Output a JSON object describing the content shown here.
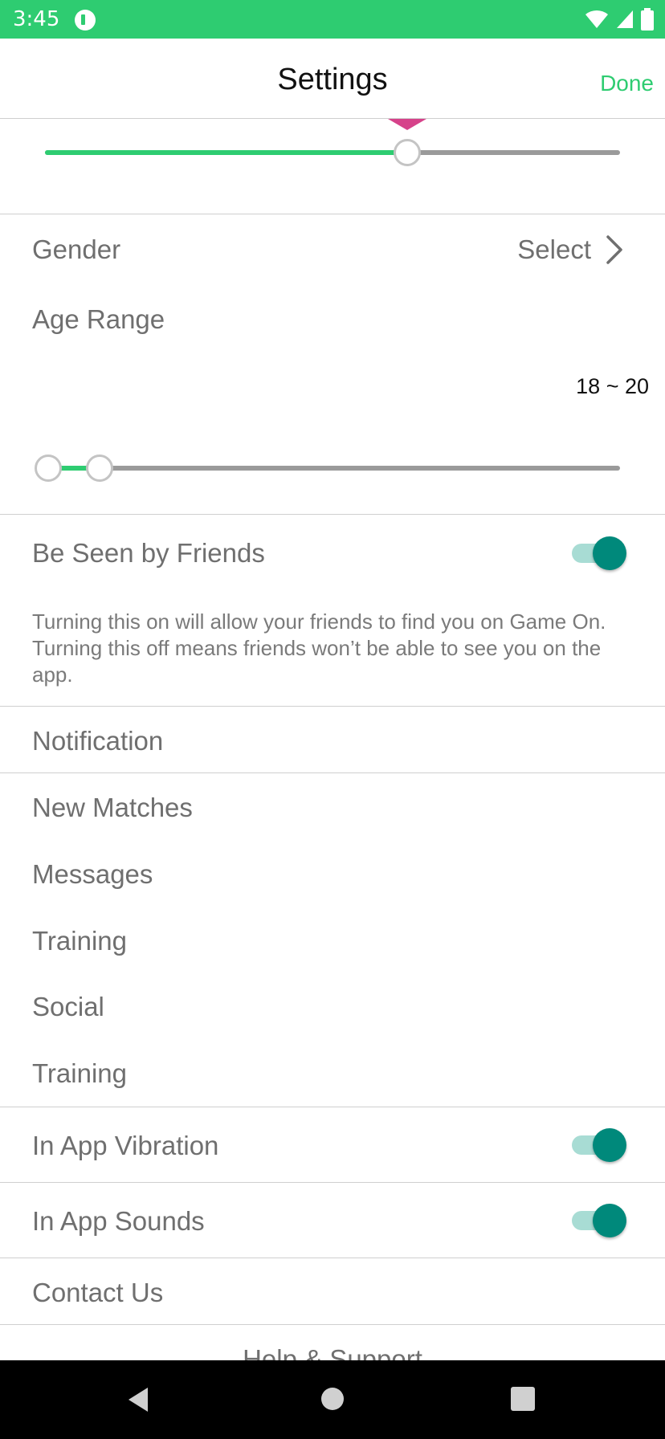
{
  "status_bar": {
    "time": "3:45",
    "icons": [
      "app-icon",
      "wifi-icon",
      "signal-icon",
      "battery-icon"
    ]
  },
  "header": {
    "title": "Settings",
    "done_label": "Done"
  },
  "distance_slider": {
    "value_fraction": 0.63
  },
  "gender": {
    "label": "Gender",
    "value": "Select"
  },
  "age_range": {
    "label": "Age Range",
    "value_text": "18 ~ 20",
    "low_fraction": 0.0,
    "high_fraction": 0.09
  },
  "be_seen": {
    "label": "Be Seen by Friends",
    "on": true,
    "description": "Turning this on will allow your friends to find you on Game On. Turning this off means friends won’t be able to see you on the app."
  },
  "notification": {
    "header": "Notification",
    "items": [
      "New Matches",
      "Messages",
      "Training",
      "Social",
      "Training"
    ]
  },
  "vibration": {
    "label": "In App Vibration",
    "on": true
  },
  "sounds": {
    "label": "In App Sounds",
    "on": true
  },
  "contact": {
    "label": "Contact Us"
  },
  "help": {
    "label": "Help & Support"
  },
  "colors": {
    "accent_green": "#2ecc71",
    "toggle_teal": "#00897b",
    "pin_pink": "#d6428a"
  }
}
